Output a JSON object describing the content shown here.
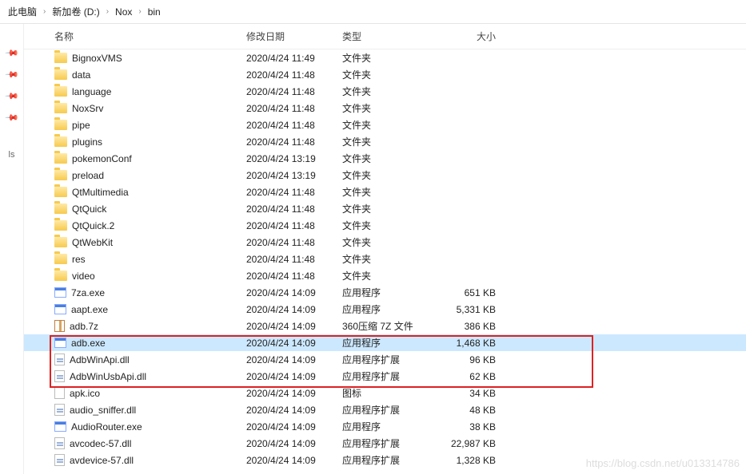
{
  "breadcrumb": {
    "parts": [
      "此电脑",
      "新加卷 (D:)",
      "Nox",
      "bin"
    ],
    "sep": "›"
  },
  "columns": {
    "name": "名称",
    "date": "修改日期",
    "type": "类型",
    "size": "大小"
  },
  "sidebar": {
    "ls": "ls"
  },
  "files": [
    {
      "icon": "folder",
      "name": "BignoxVMS",
      "date": "2020/4/24 11:49",
      "type": "文件夹",
      "size": ""
    },
    {
      "icon": "folder",
      "name": "data",
      "date": "2020/4/24 11:48",
      "type": "文件夹",
      "size": ""
    },
    {
      "icon": "folder",
      "name": "language",
      "date": "2020/4/24 11:48",
      "type": "文件夹",
      "size": ""
    },
    {
      "icon": "folder",
      "name": "NoxSrv",
      "date": "2020/4/24 11:48",
      "type": "文件夹",
      "size": ""
    },
    {
      "icon": "folder",
      "name": "pipe",
      "date": "2020/4/24 11:48",
      "type": "文件夹",
      "size": ""
    },
    {
      "icon": "folder",
      "name": "plugins",
      "date": "2020/4/24 11:48",
      "type": "文件夹",
      "size": ""
    },
    {
      "icon": "folder",
      "name": "pokemonConf",
      "date": "2020/4/24 13:19",
      "type": "文件夹",
      "size": ""
    },
    {
      "icon": "folder",
      "name": "preload",
      "date": "2020/4/24 13:19",
      "type": "文件夹",
      "size": ""
    },
    {
      "icon": "folder",
      "name": "QtMultimedia",
      "date": "2020/4/24 11:48",
      "type": "文件夹",
      "size": ""
    },
    {
      "icon": "folder",
      "name": "QtQuick",
      "date": "2020/4/24 11:48",
      "type": "文件夹",
      "size": ""
    },
    {
      "icon": "folder",
      "name": "QtQuick.2",
      "date": "2020/4/24 11:48",
      "type": "文件夹",
      "size": ""
    },
    {
      "icon": "folder",
      "name": "QtWebKit",
      "date": "2020/4/24 11:48",
      "type": "文件夹",
      "size": ""
    },
    {
      "icon": "folder",
      "name": "res",
      "date": "2020/4/24 11:48",
      "type": "文件夹",
      "size": ""
    },
    {
      "icon": "folder",
      "name": "video",
      "date": "2020/4/24 11:48",
      "type": "文件夹",
      "size": ""
    },
    {
      "icon": "exe",
      "name": "7za.exe",
      "date": "2020/4/24 14:09",
      "type": "应用程序",
      "size": "651 KB"
    },
    {
      "icon": "exe",
      "name": "aapt.exe",
      "date": "2020/4/24 14:09",
      "type": "应用程序",
      "size": "5,331 KB"
    },
    {
      "icon": "archive",
      "name": "adb.7z",
      "date": "2020/4/24 14:09",
      "type": "360压缩 7Z 文件",
      "size": "386 KB"
    },
    {
      "icon": "exe",
      "name": "adb.exe",
      "date": "2020/4/24 14:09",
      "type": "应用程序",
      "size": "1,468 KB",
      "selected": true
    },
    {
      "icon": "dll",
      "name": "AdbWinApi.dll",
      "date": "2020/4/24 14:09",
      "type": "应用程序扩展",
      "size": "96 KB"
    },
    {
      "icon": "dll",
      "name": "AdbWinUsbApi.dll",
      "date": "2020/4/24 14:09",
      "type": "应用程序扩展",
      "size": "62 KB"
    },
    {
      "icon": "ico",
      "name": "apk.ico",
      "date": "2020/4/24 14:09",
      "type": "图标",
      "size": "34 KB"
    },
    {
      "icon": "dll",
      "name": "audio_sniffer.dll",
      "date": "2020/4/24 14:09",
      "type": "应用程序扩展",
      "size": "48 KB"
    },
    {
      "icon": "exe",
      "name": "AudioRouter.exe",
      "date": "2020/4/24 14:09",
      "type": "应用程序",
      "size": "38 KB"
    },
    {
      "icon": "dll",
      "name": "avcodec-57.dll",
      "date": "2020/4/24 14:09",
      "type": "应用程序扩展",
      "size": "22,987 KB"
    },
    {
      "icon": "dll",
      "name": "avdevice-57.dll",
      "date": "2020/4/24 14:09",
      "type": "应用程序扩展",
      "size": "1,328 KB"
    }
  ],
  "watermark": "https://blog.csdn.net/u013314786"
}
